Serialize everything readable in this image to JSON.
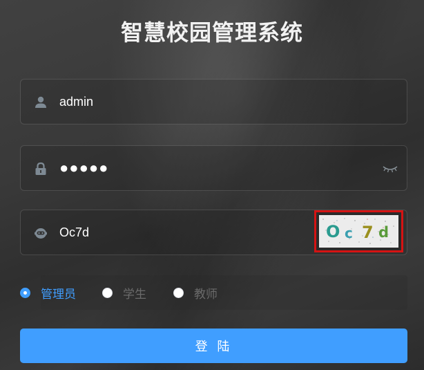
{
  "page": {
    "title": "智慧校园管理系统"
  },
  "form": {
    "username": {
      "value": "admin",
      "icon": "user-icon"
    },
    "password": {
      "value": "●●●●●",
      "icon": "lock-icon",
      "toggle_icon": "eye-closed-icon"
    },
    "captcha": {
      "value": "Oc7d",
      "icon": "robot-icon",
      "image_text": "Oc7d"
    }
  },
  "roles": {
    "selected": "管理员",
    "options": [
      "管理员",
      "学生",
      "教师"
    ]
  },
  "login": {
    "label": "登 陆"
  },
  "colors": {
    "accent": "#409eff",
    "captcha_highlight": "#d51313"
  }
}
